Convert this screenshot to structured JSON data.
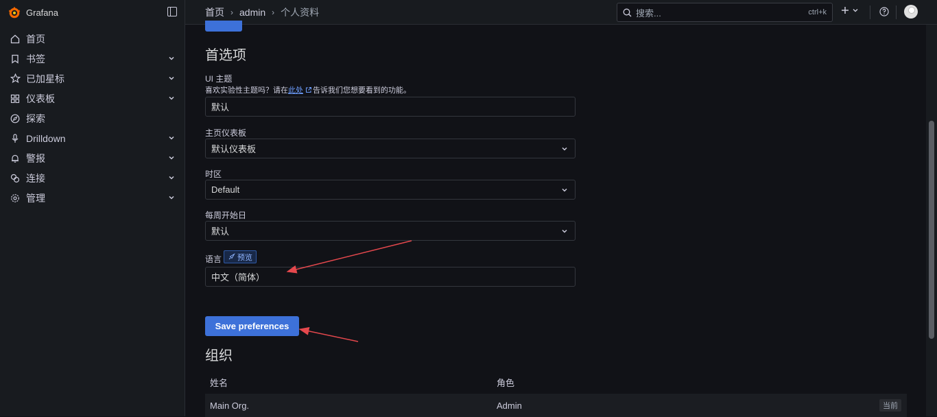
{
  "brand": {
    "name": "Grafana"
  },
  "sidebar": {
    "items": [
      {
        "label": "首页",
        "icon": "home-icon",
        "expandable": false
      },
      {
        "label": "书签",
        "icon": "bookmark-icon",
        "expandable": true
      },
      {
        "label": "已加星标",
        "icon": "star-icon",
        "expandable": true
      },
      {
        "label": "仪表板",
        "icon": "dashboards-icon",
        "expandable": true
      },
      {
        "label": "探索",
        "icon": "compass-icon",
        "expandable": false
      },
      {
        "label": "Drilldown",
        "icon": "microphone-icon",
        "expandable": true
      },
      {
        "label": "警报",
        "icon": "bell-icon",
        "expandable": true
      },
      {
        "label": "连接",
        "icon": "link-icon",
        "expandable": true
      },
      {
        "label": "管理",
        "icon": "cog-icon",
        "expandable": true
      }
    ]
  },
  "topbar": {
    "breadcrumbs": [
      "首页",
      "admin",
      "个人资料"
    ],
    "search_placeholder": "搜索...",
    "search_shortcut": "ctrl+k"
  },
  "preferences": {
    "title": "首选项",
    "ui_theme": {
      "label": "UI 主题",
      "desc_before": "喜欢实验性主题吗？请在",
      "desc_link": "此处",
      "desc_after": "告诉我们您想要看到的功能。",
      "value": "默认"
    },
    "home_dashboard": {
      "label": "主页仪表板",
      "value": "默认仪表板"
    },
    "timezone": {
      "label": "时区",
      "value": "Default"
    },
    "week_start": {
      "label": "每周开始日",
      "value": "默认"
    },
    "language": {
      "label": "语言",
      "badge": "预览",
      "value": "中文（简体）"
    },
    "save_label": "Save preferences"
  },
  "organizations": {
    "title": "组织",
    "columns": [
      "姓名",
      "角色"
    ],
    "rows": [
      {
        "name": "Main Org.",
        "role": "Admin",
        "tag": "当前"
      }
    ]
  },
  "colors": {
    "primary": "#3d71d9",
    "annotation": "#e5484d",
    "background": "#111217",
    "panel": "#181b1f"
  }
}
